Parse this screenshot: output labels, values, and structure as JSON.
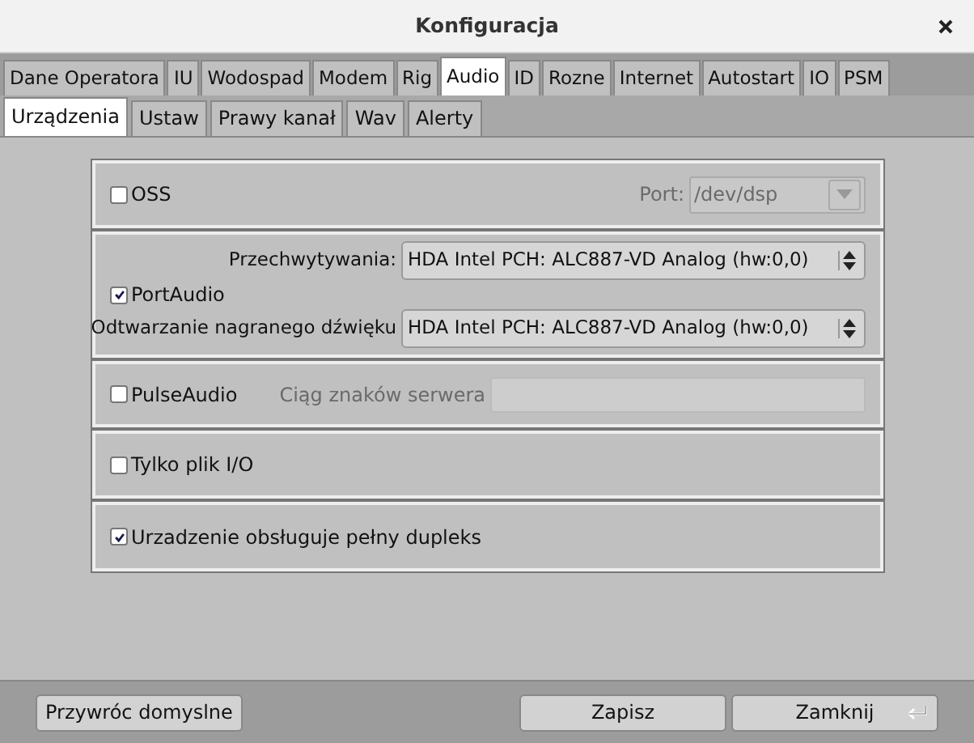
{
  "window": {
    "title": "Konfiguracja"
  },
  "tabs": [
    {
      "label": "Dane Operatora",
      "selected": false
    },
    {
      "label": "IU",
      "selected": false
    },
    {
      "label": "Wodospad",
      "selected": false
    },
    {
      "label": "Modem",
      "selected": false
    },
    {
      "label": "Rig",
      "selected": false
    },
    {
      "label": "Audio",
      "selected": true
    },
    {
      "label": "ID",
      "selected": false
    },
    {
      "label": "Rozne",
      "selected": false
    },
    {
      "label": "Internet",
      "selected": false
    },
    {
      "label": "Autostart",
      "selected": false
    },
    {
      "label": "IO",
      "selected": false
    },
    {
      "label": "PSM",
      "selected": false
    }
  ],
  "subtabs": [
    {
      "label": "Urządzenia",
      "selected": true
    },
    {
      "label": "Ustaw",
      "selected": false
    },
    {
      "label": "Prawy kanał",
      "selected": false
    },
    {
      "label": "Wav",
      "selected": false
    },
    {
      "label": "Alerty",
      "selected": false
    }
  ],
  "oss": {
    "label": "OSS",
    "checked": false,
    "port_label": "Port:",
    "port_value": "/dev/dsp"
  },
  "portaudio": {
    "label": "PortAudio",
    "checked": true,
    "capture_label": "Przechwytywania:",
    "capture_value": "HDA Intel PCH: ALC887-VD Analog (hw:0,0)",
    "playback_label": "Odtwarzanie nagranego dźwięku",
    "playback_value": "HDA Intel PCH: ALC887-VD Analog (hw:0,0)"
  },
  "pulseaudio": {
    "label": "PulseAudio",
    "checked": false,
    "server_label": "Ciąg znaków serwera"
  },
  "file_io": {
    "label": "Tylko plik I/O",
    "checked": false
  },
  "full_duplex": {
    "label": "Urzadzenie obsługuje pełny dupleks",
    "checked": true
  },
  "buttons": {
    "restore": "Przywróc domyslne",
    "save": "Zapisz",
    "close": "Zamknij"
  }
}
